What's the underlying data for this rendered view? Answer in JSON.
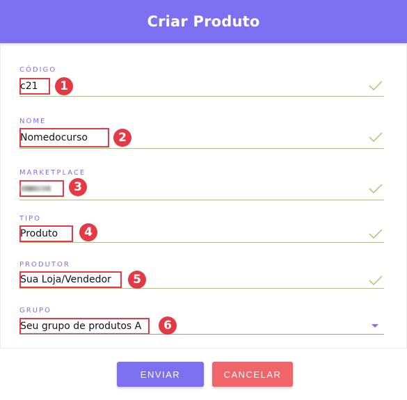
{
  "header": {
    "title": "Criar Produto"
  },
  "fields": [
    {
      "label": "CÓDIGO",
      "value": "c21",
      "badge": "1",
      "valid": true
    },
    {
      "label": "NOME",
      "value": "Nomedocurso",
      "badge": "2",
      "valid": true
    },
    {
      "label": "MARKETPLACE",
      "value": "",
      "badge": "3",
      "valid": true
    },
    {
      "label": "TIPO",
      "value": "Produto",
      "badge": "4",
      "valid": true
    },
    {
      "label": "PRODUTOR",
      "value": "Sua Loja/Vendedor",
      "badge": "5",
      "valid": true
    },
    {
      "label": "GRUPO",
      "value": "Seu grupo de produtos A",
      "badge": "6",
      "valid": false
    }
  ],
  "actions": {
    "submit_label": "ENVIAR",
    "cancel_label": "CANCELAR"
  },
  "colors": {
    "accent": "#7c6ff0",
    "valid": "#a6c86a",
    "highlight": "#e53945",
    "cancel": "#f0646a"
  },
  "icons": {
    "valid": "check-icon",
    "dropdown": "dropdown-arrow-icon"
  }
}
